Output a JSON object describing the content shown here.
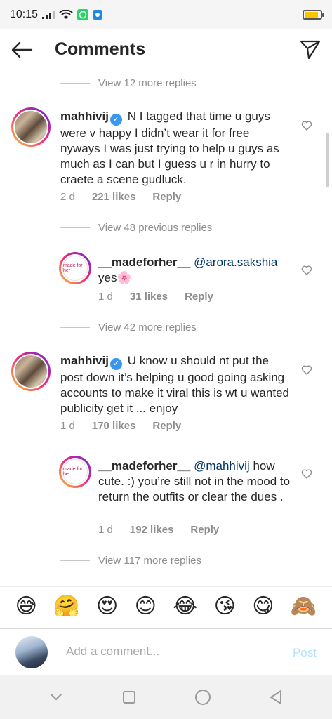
{
  "status_bar": {
    "time": "10:15",
    "battery_level": 0.85,
    "battery_color": "#f5c500",
    "icons": [
      "signal-icon",
      "wifi-icon",
      "whatsapp-icon",
      "notification-icon"
    ]
  },
  "header": {
    "title": "Comments",
    "back_icon": "arrow-left-icon",
    "send_icon": "paper-plane-icon"
  },
  "view_replies": [
    "View 12 more replies",
    "View 48 previous replies",
    "View 42 more replies",
    "View 117 more replies"
  ],
  "comments": [
    {
      "username": "mahhivij",
      "verified": true,
      "text": "N I tagged that time u guys were v happy I didn’t wear it for free nyways I was just trying to help u guys as much as I can but I guess u r in hurry to craete a scene gudluck.",
      "time": "2 d",
      "likes": "221 likes",
      "reply": "Reply"
    },
    {
      "username": "__madeforher__",
      "mention": "@arora.sakshia",
      "text": "yes🌸",
      "time": "1 d",
      "likes": "31 likes",
      "reply": "Reply"
    },
    {
      "username": "mahhivij",
      "verified": true,
      "text": "U know u should nt put the post down it’s helping u good going asking accounts to make it viral this is wt u wanted publicity get it ... enjoy",
      "time": "1 d",
      "likes": "170 likes",
      "reply": "Reply"
    },
    {
      "username": "__madeforher__",
      "mention": "@mahhivij",
      "text": "how cute. :) you’re still not in the mood to return the outfits or clear the dues .",
      "time": "1 d",
      "likes": "192 likes",
      "reply": "Reply"
    }
  ],
  "avatar_logo_text": "made for her",
  "emojis": [
    "😅",
    "🤗",
    "😍",
    "😊",
    "😂",
    "😘",
    "😋",
    "🙈"
  ],
  "composer": {
    "placeholder": "Add a comment...",
    "post_label": "Post",
    "post_color": "#b2dffc"
  },
  "nav_bar": {
    "icons": [
      "chevron-down-icon",
      "square-icon",
      "circle-icon",
      "triangle-back-icon"
    ]
  }
}
